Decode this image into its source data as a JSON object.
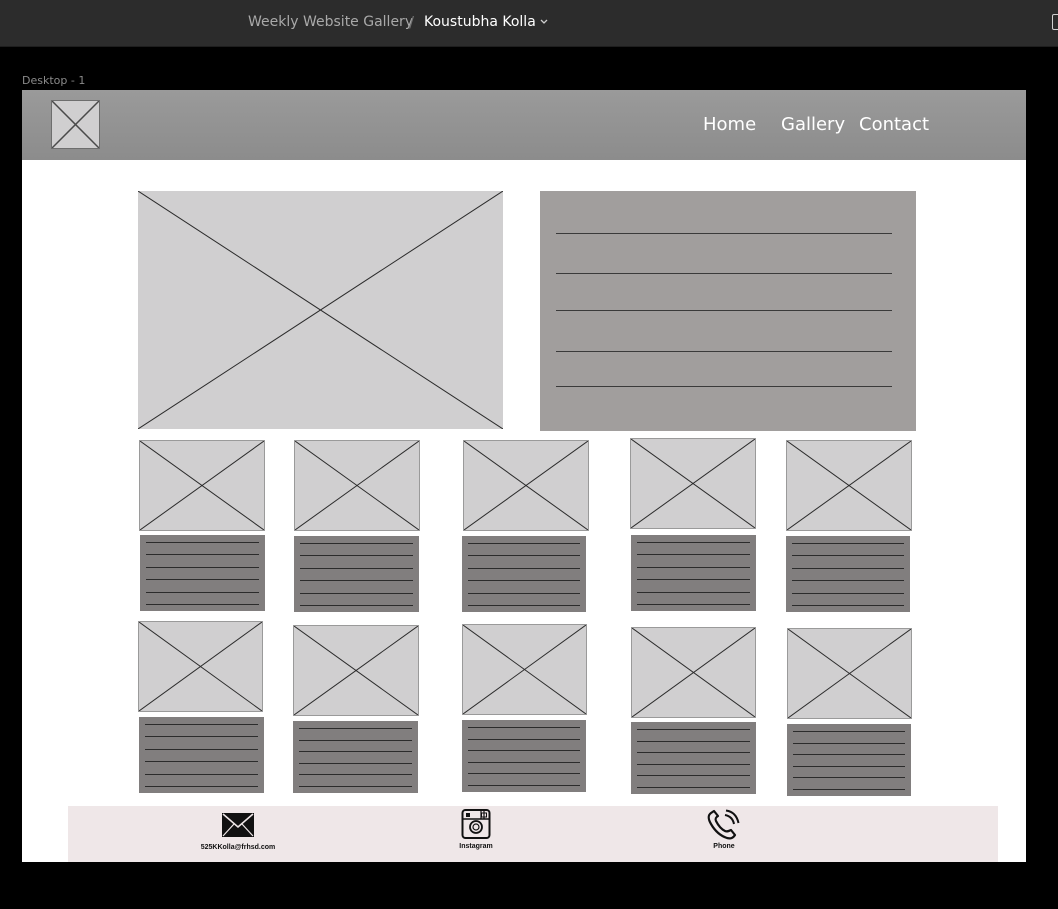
{
  "app": {
    "breadcrumb_project": "Weekly Website Gallery",
    "breadcrumb_separator": "/",
    "breadcrumb_file": "Koustubha Kolla",
    "frame_label": "Desktop - 1"
  },
  "nav": {
    "links": [
      "Home",
      "Gallery",
      "Contact"
    ]
  },
  "footer": {
    "email_label": "525KKolla@frhsd.com",
    "instagram_label": "Instagram",
    "phone_label": "Phone"
  },
  "colors": {
    "topbar": "#2c2c2c",
    "canvas": "#000000",
    "nav_bar": "#8e8e8e",
    "placeholder": "#d0cfd0",
    "hero_text_block": "#a19e9d",
    "card_text_block": "#817e7e",
    "footer": "#efe7e8"
  },
  "icons": {
    "breadcrumb": "chevron-down-icon",
    "footer": [
      "envelope-icon",
      "instagram-icon",
      "phone-icon"
    ]
  }
}
